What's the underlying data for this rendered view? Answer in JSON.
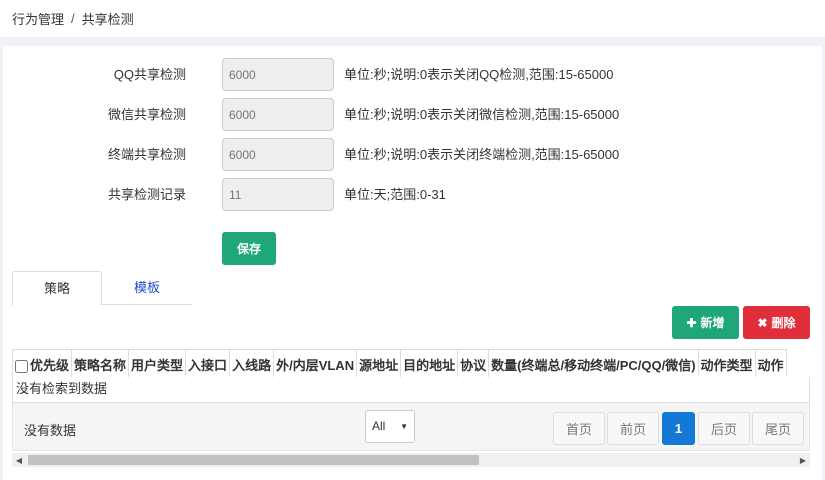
{
  "breadcrumb": {
    "parent": "行为管理",
    "separator": "/",
    "current": "共享检测"
  },
  "form": {
    "rows": [
      {
        "label": "QQ共享检测",
        "value": "6000",
        "hint": "单位:秒;说明:0表示关闭QQ检测,范围:15-65000"
      },
      {
        "label": "微信共享检测",
        "value": "6000",
        "hint": "单位:秒;说明:0表示关闭微信检测,范围:15-65000"
      },
      {
        "label": "终端共享检测",
        "value": "6000",
        "hint": "单位:秒;说明:0表示关闭终端检测,范围:15-65000"
      },
      {
        "label": "共享检测记录",
        "value": "11",
        "hint": "单位:天;范围:0-31"
      }
    ],
    "save_label": "保存"
  },
  "tabs": [
    {
      "label": "策略",
      "active": true
    },
    {
      "label": "模板",
      "active": false
    }
  ],
  "toolbar": {
    "add_label": "新增",
    "add_icon": "plus-icon",
    "delete_label": "删除",
    "delete_icon": "times-icon"
  },
  "table": {
    "columns": [
      "优先级",
      "策略名称",
      "用户类型",
      "入接口",
      "入线路",
      "外/内层VLAN",
      "源地址",
      "目的地址",
      "协议",
      "数量(终端总/移动终端/PC/QQ/微信)",
      "动作类型",
      "动作"
    ],
    "empty_text": "没有检索到数据"
  },
  "footer": {
    "nodata_label": "没有数据",
    "page_size": "All",
    "pagination": {
      "first": "首页",
      "prev": "前页",
      "current": "1",
      "next": "后页",
      "last": "尾页"
    }
  },
  "colors": {
    "primary": "#1fa67a",
    "danger": "#e02e3b",
    "active_page": "#1479d4",
    "tab_link": "#1f4fc9"
  }
}
